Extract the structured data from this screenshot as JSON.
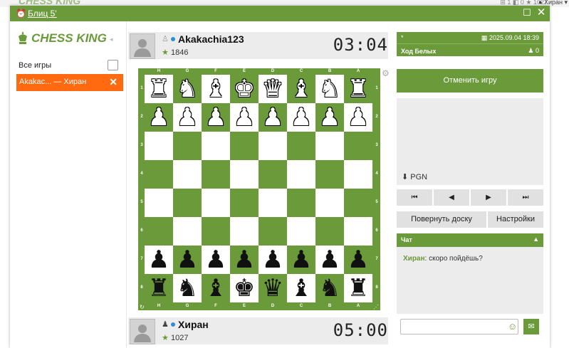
{
  "background": {
    "logo_text": "CHESS KING",
    "stats": "⊞ 1   ◧ 0   ★ 1027",
    "user": "● Хиран ▾"
  },
  "window": {
    "title": "Блиц 5'",
    "accent": "#6a9a3a",
    "maximize_icon": "☐",
    "close_icon": "✕"
  },
  "sidebar": {
    "logo_text": "CHESS KING",
    "collapse_icon": "◂",
    "all_games_label": "Все игры",
    "active_game": {
      "label": "Akakac...  — Хиран",
      "close_icon": "✕",
      "color": "#ff6a10"
    }
  },
  "top_player": {
    "name": "Akakachia123",
    "rating": "1846",
    "clock": "03:04",
    "piece_icon": "♙"
  },
  "bottom_player": {
    "name": "Хиран",
    "rating": "1027",
    "clock": "05:00",
    "piece_icon": "♟"
  },
  "board": {
    "files": [
      "H",
      "G",
      "F",
      "E",
      "D",
      "C",
      "B",
      "A"
    ],
    "ranks": [
      "1",
      "2",
      "3",
      "4",
      "5",
      "6",
      "7",
      "8"
    ],
    "rows": [
      [
        "♜",
        "♞",
        "♝",
        "♚",
        "♛",
        "♝",
        "♞",
        "♜"
      ],
      [
        "♟",
        "♟",
        "♟",
        "♟",
        "♟",
        "♟",
        "♟",
        "♟"
      ],
      [
        "",
        "",
        "",
        "",
        "",
        "",
        "",
        ""
      ],
      [
        "",
        "",
        "",
        "",
        "",
        "",
        "",
        ""
      ],
      [
        "",
        "",
        "",
        "",
        "",
        "",
        "",
        ""
      ],
      [
        "",
        "",
        "",
        "",
        "",
        "",
        "",
        ""
      ],
      [
        "♟",
        "♟",
        "♟",
        "♟",
        "♟",
        "♟",
        "♟",
        "♟"
      ],
      [
        "♜",
        "♞",
        "♝",
        "♚",
        "♛",
        "♝",
        "♞",
        "♜"
      ]
    ],
    "row_colors": [
      "white",
      "white",
      "",
      "",
      "",
      "",
      "black",
      "black"
    ],
    "light_color": "#ffffff",
    "dark_color": "#6a9a3a",
    "settings_icon": "⚙"
  },
  "game_info": {
    "marker": "*",
    "date": "2025.09.04 18:39",
    "turn": "Ход Белых",
    "pawn_count": "0"
  },
  "controls": {
    "cancel_game": "Отменить игру",
    "pgn_label": "PGN",
    "nav": [
      "⏮",
      "◀",
      "▶",
      "⏭"
    ],
    "flip_board": "Повернуть доску",
    "settings": "Настройки"
  },
  "chat": {
    "title": "Чат",
    "collapse_icon": "▲",
    "messages": [
      {
        "author": "Хиран",
        "text": " скоро пойдёшь?"
      }
    ],
    "input_placeholder": "",
    "smile_icon": "☺",
    "send_icon": "✉"
  }
}
